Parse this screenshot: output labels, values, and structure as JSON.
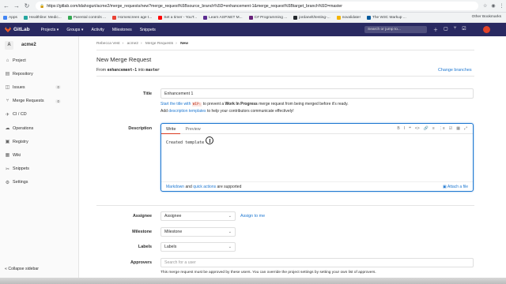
{
  "browser": {
    "url": "https://gitlab.com/idahoguri/acme2/merge_requests/new?merge_request%5Bsource_branch%5D=enhancement-1&merge_request%5Btarget_branch%5D=master",
    "bookmarks": [
      {
        "label": "Apps",
        "color": "#4285f4"
      },
      {
        "label": "Healthline: Medic...",
        "color": "#25a7a0"
      },
      {
        "label": "Parental controls ...",
        "color": "#34a853"
      },
      {
        "label": "Homescreen age t...",
        "color": "#ea4335"
      },
      {
        "label": "Set a timer - YouT...",
        "color": "#ff0000"
      },
      {
        "label": "Learn ASP.NET M...",
        "color": "#5c2d91"
      },
      {
        "label": "C# Programming ...",
        "color": "#68217a"
      },
      {
        "label": "jordanelt/testing-...",
        "color": "#24292e"
      },
      {
        "label": "novalidate!",
        "color": "#f4b400"
      },
      {
        "label": "The W3C Markup ...",
        "color": "#005a9c"
      }
    ],
    "other_bookmarks": "Other Bookmarks"
  },
  "navbar": {
    "brand": "GitLab",
    "menu": [
      "Projects ▾",
      "Groups ▾",
      "Activity",
      "Milestones",
      "Snippets"
    ],
    "search_placeholder": "Search or jump to..."
  },
  "sidebar": {
    "project_initial": "A",
    "project_name": "acme2",
    "items": [
      {
        "label": "Project",
        "icon": "home-icon",
        "glyph": "⌂",
        "count": ""
      },
      {
        "label": "Repository",
        "icon": "book-icon",
        "glyph": "▤",
        "count": ""
      },
      {
        "label": "Issues",
        "icon": "issues-icon",
        "glyph": "◫",
        "count": "0"
      },
      {
        "label": "Merge Requests",
        "icon": "merge-request-icon",
        "glyph": "⑂",
        "count": "0"
      },
      {
        "label": "CI / CD",
        "icon": "rocket-icon",
        "glyph": "✈",
        "count": ""
      },
      {
        "label": "Operations",
        "icon": "cloud-gear-icon",
        "glyph": "☁",
        "count": ""
      },
      {
        "label": "Registry",
        "icon": "container-icon",
        "glyph": "▣",
        "count": ""
      },
      {
        "label": "Wiki",
        "icon": "wiki-icon",
        "glyph": "▦",
        "count": ""
      },
      {
        "label": "Snippets",
        "icon": "snippet-icon",
        "glyph": "✂",
        "count": ""
      },
      {
        "label": "Settings",
        "icon": "settings-icon",
        "glyph": "⚙",
        "count": ""
      }
    ],
    "collapse_label": "Collapse sidebar"
  },
  "breadcrumbs": [
    "Rebecca Vest",
    "acme2",
    "Merge Requests",
    "New"
  ],
  "page": {
    "title": "New Merge Request",
    "from_prefix": "From",
    "source_branch": "enhancement-1",
    "into_word": "into",
    "target_branch": "master",
    "change_branches": "Change branches"
  },
  "form": {
    "title_label": "Title",
    "title_value": "Enhancement 1",
    "title_help_1": "Start the title with",
    "title_help_code": "WIP:",
    "title_help_2": "to prevent a",
    "title_help_bold": "Work In Progress",
    "title_help_3": "merge request from being merged before it's ready.",
    "templates_1": "Add",
    "templates_link": "description templates",
    "templates_2": "to help your contributors communicate effectively!",
    "description_label": "Description",
    "tab_write": "Write",
    "tab_preview": "Preview",
    "toolbar": [
      "B",
      "I",
      "❝",
      "<>",
      "🔗",
      "≡",
      "⋮≡",
      "☑",
      "▦",
      "⤢"
    ],
    "description_value": "Created template",
    "footer_markdown": "Markdown",
    "footer_and": "and",
    "footer_quick": "quick actions",
    "footer_rest": "are supported",
    "attach_label": "Attach a file",
    "assignee_label": "Assignee",
    "assignee_value": "Assignee",
    "assign_to_me": "Assign to me",
    "milestone_label": "Milestone",
    "milestone_value": "Milestone",
    "labels_label": "Labels",
    "labels_value": "Labels",
    "approvers_label": "Approvers",
    "approvers_placeholder": "Search for a user",
    "approvers_help": "This merge request must be approved by these users. You can override the project settings by setting your own list of approvers."
  }
}
